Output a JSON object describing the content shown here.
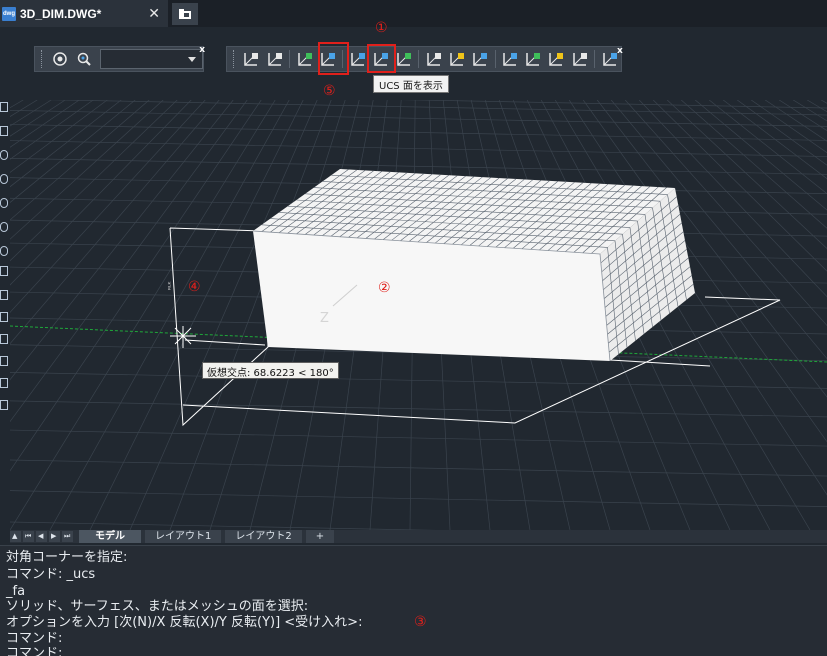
{
  "document_tab": {
    "file_icon": "dwg",
    "filename": "3D_DIM.DWG*",
    "close": "✕"
  },
  "toolbar_close": "x",
  "tooltip": "UCS 面を表示",
  "annotations": {
    "m1": "①",
    "m2": "②",
    "m3": "③",
    "m4": "④",
    "m5": "⑤",
    "color": "#e0201b"
  },
  "ucs_toolbar_icons": [
    "ucs-icon",
    "ucs-origin-icon",
    "ucs-world-icon",
    "ucs-view-icon",
    "ucs-face-icon",
    "ucs-object-icon",
    "ucs-3point-icon",
    "ucs-x-rotate-icon",
    "ucs-y-rotate-icon",
    "ucs-z-rotate-icon",
    "ucs-zaxis-icon",
    "ucs-named-icon",
    "ucs-previous-icon",
    "ucs-apply-icon",
    "ucs-settings-icon"
  ],
  "dynamic_tooltip": "仮想交点: 68.6223 < 180°",
  "layout_tabs": [
    "モデル",
    "レイアウト1",
    "レイアウト2",
    "+"
  ],
  "active_layout_tab": "モデル",
  "command_history": [
    "対角コーナーを指定:",
    "コマンド: _ucs",
    "_fa",
    "ソリッド、サーフェス、またはメッシュの面を選択:",
    "オプションを入力 [次(N)/X 反転(X)/Y 反転(Y)] <受け入れ>:",
    "コマンド:",
    "コマンド:"
  ],
  "colors": {
    "background": "#212830",
    "grid": "#3a434d",
    "box_face": "#f4f4f4",
    "box_mesh": "#5a6470",
    "dimension_lines": "#ffffff",
    "ground_line": "#1fa83a"
  }
}
